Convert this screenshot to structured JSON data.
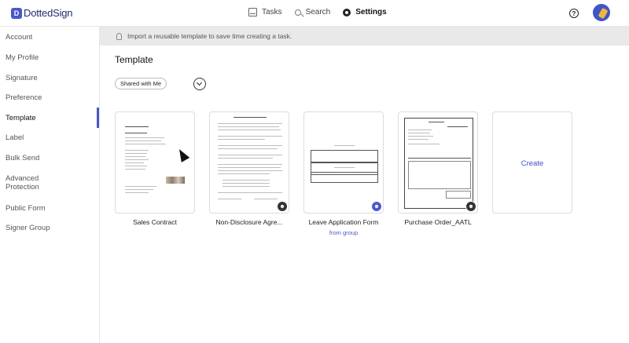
{
  "app": {
    "logo_text": "DottedSign",
    "logo_badge": "D"
  },
  "nav": {
    "tasks": "Tasks",
    "search": "Search",
    "settings": "Settings"
  },
  "sidebar": {
    "items": [
      {
        "label": "Account"
      },
      {
        "label": "My Profile"
      },
      {
        "label": "Signature"
      },
      {
        "label": "Preference"
      },
      {
        "label": "Template"
      },
      {
        "label": "Label"
      },
      {
        "label": "Bulk Send"
      },
      {
        "label": "Advanced Protection"
      },
      {
        "label": "Public Form"
      },
      {
        "label": "Signer Group"
      }
    ],
    "active": "Template"
  },
  "banner": {
    "text": "Import a reusable template to save time creating a task."
  },
  "main": {
    "title": "Template",
    "filter_label": "Shared with Me"
  },
  "templates": [
    {
      "name": "Sales Contract"
    },
    {
      "name": "Non-Disclosure Agre..."
    },
    {
      "name": "Leave Application Form",
      "sub": "from group"
    },
    {
      "name": "Purchase Order_AATL"
    }
  ],
  "create_label": "Create",
  "colors": {
    "accent": "#4a57c8",
    "banner_bg": "#e9e9e9"
  }
}
